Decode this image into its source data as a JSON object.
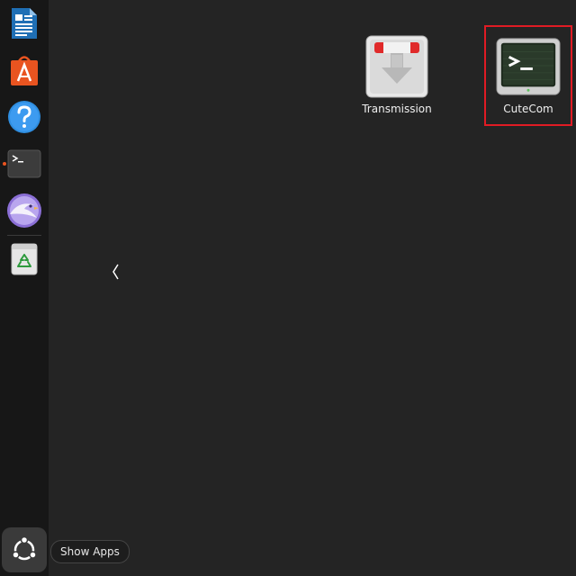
{
  "dock": {
    "items": [
      {
        "name": "LibreOffice Writer",
        "icon": "writer-document-icon"
      },
      {
        "name": "App Center",
        "icon": "app-center-icon"
      },
      {
        "name": "Help",
        "icon": "help-icon"
      },
      {
        "name": "Terminal",
        "icon": "terminal-icon",
        "running": true
      },
      {
        "name": "Web Browser",
        "icon": "browser-bird-icon"
      },
      {
        "name": "Trash",
        "icon": "trash-icon"
      }
    ],
    "show_apps": {
      "icon": "ubuntu-grid-icon",
      "tooltip": "Show Apps"
    }
  },
  "app_grid": {
    "apps": [
      {
        "label": "Transmission",
        "icon": "transmission-icon"
      },
      {
        "label": "CuteCom",
        "icon": "cutecom-terminal-icon",
        "selected": true
      }
    ]
  },
  "colors": {
    "background": "#242424",
    "dock": "#171717",
    "accent": "#e95420",
    "selection": "#e01b24"
  }
}
